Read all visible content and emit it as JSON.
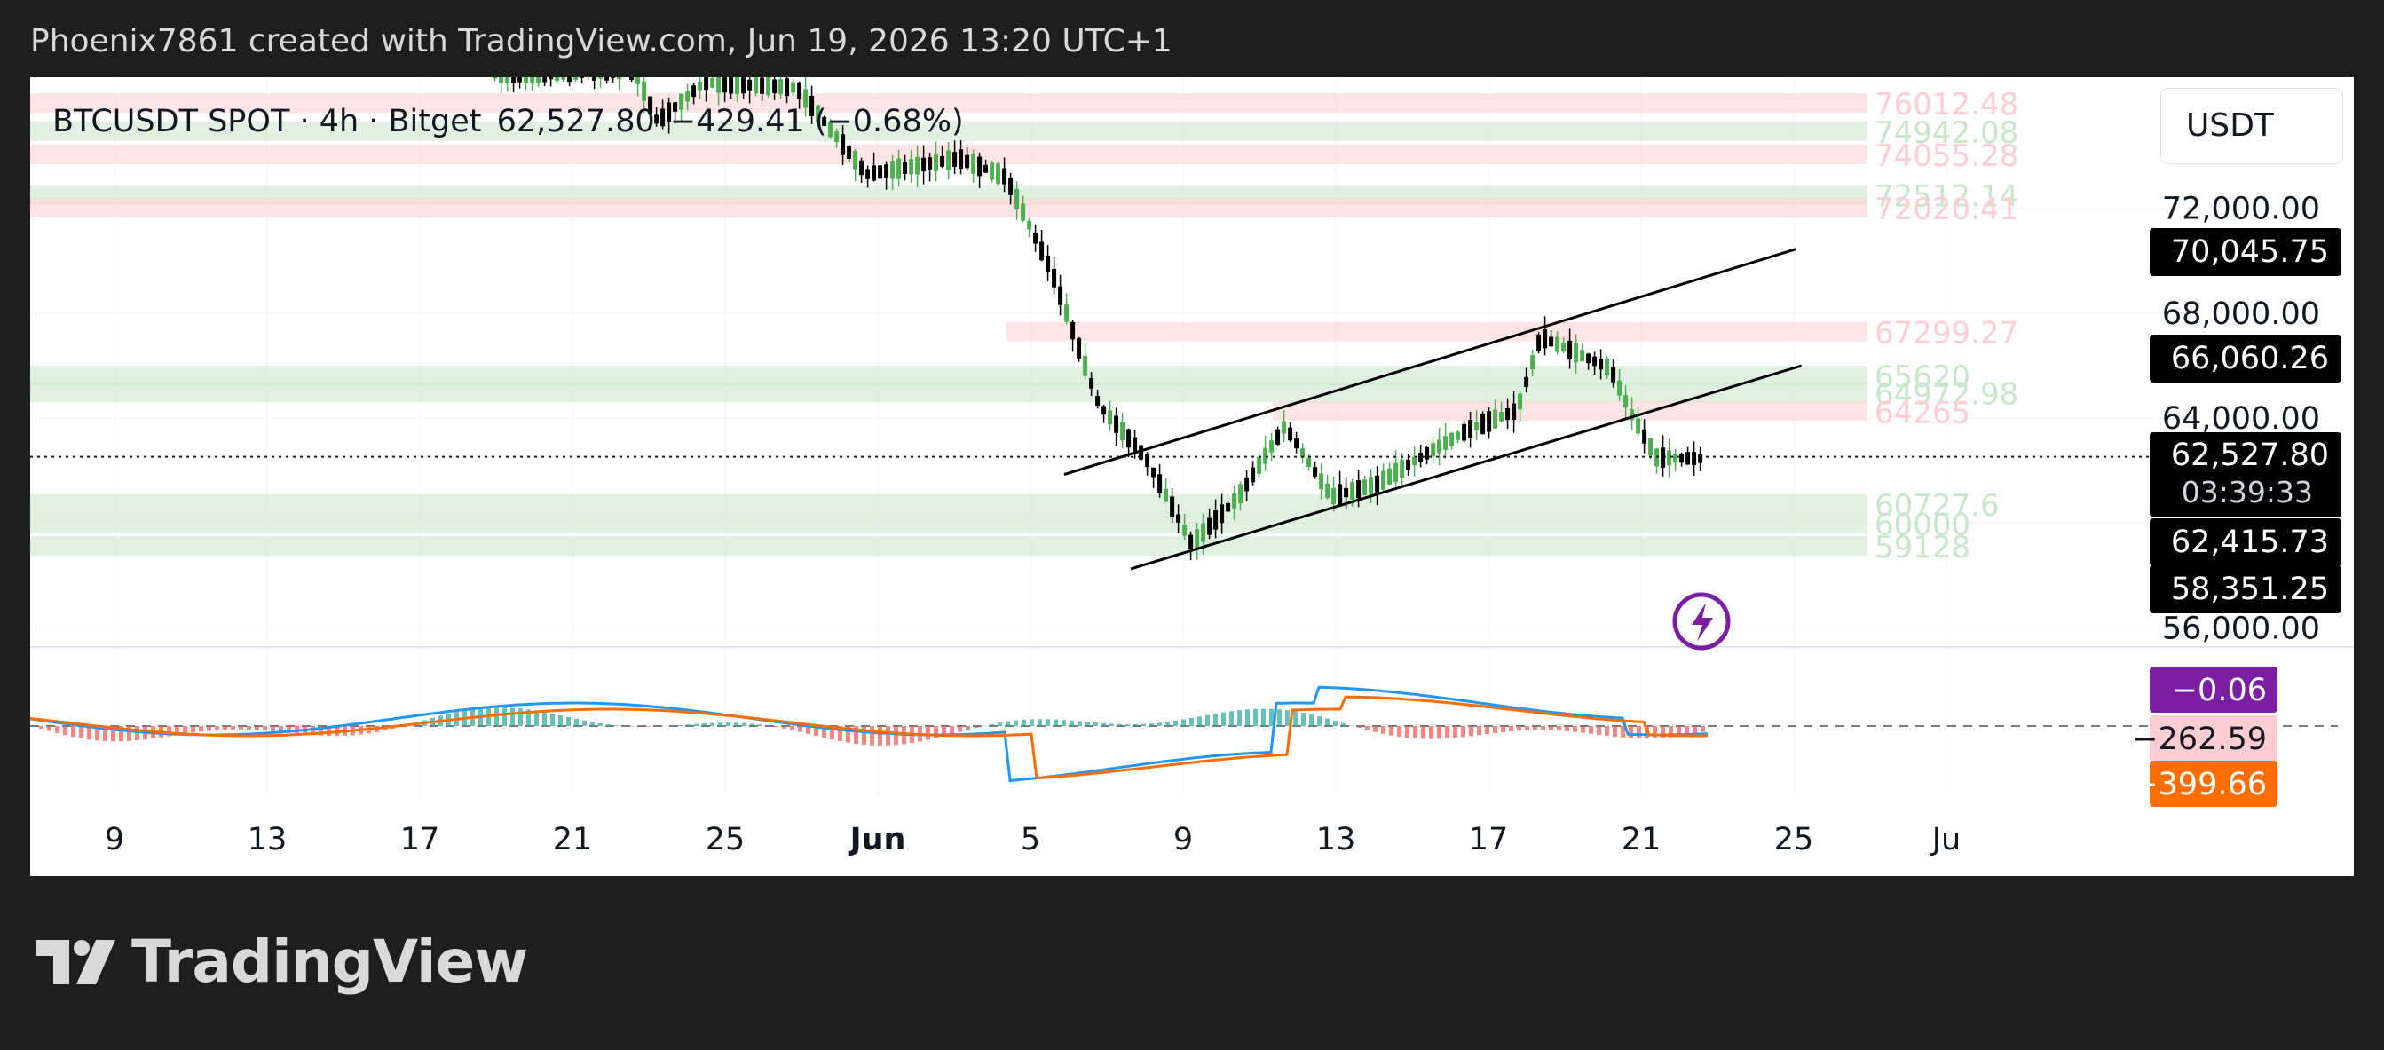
{
  "caption": "Phoenix7861 created with TradingView.com, Jun 19, 2026 13:20 UTC+1",
  "legend": {
    "symbol": "BTCUSDT SPOT · 4h · Bitget",
    "price": "62,527.80",
    "change": "−429.41 (−0.68%)"
  },
  "currency": "USDT",
  "brand": "TradingView",
  "colors": {
    "bull": "#4caf50",
    "bear": "#000000",
    "support_zone": "#c8e6c9",
    "resistance_zone": "#ffcdd2",
    "macd": "#2196f3",
    "signal": "#ff6d00",
    "hist_pos": "#26a69a",
    "hist_neg": "#ef5350",
    "badge_violet": "#7b1fa2"
  },
  "chart_data": {
    "type": "candlestick",
    "title": "BTCUSDT SPOT · 4h · Bitget",
    "timeframe": "4h",
    "x_ticks": [
      "9",
      "13",
      "17",
      "21",
      "25",
      "Jun",
      "5",
      "9",
      "13",
      "17",
      "21",
      "25",
      "Ju"
    ],
    "y_ticks": [
      "72,000.00",
      "68,000.00",
      "64,000.00",
      "56,000.00"
    ],
    "ylim": [
      55000,
      77000
    ],
    "grid": true,
    "last_price": 62527.8,
    "countdown": "03:39:33",
    "price_badges": [
      {
        "text": "70,045.75",
        "value": 70045.75
      },
      {
        "text": "66,060.26",
        "value": 66060.26
      },
      {
        "text": "62,415.73",
        "value": 62415.73
      },
      {
        "text": "58,351.25",
        "value": 58351.25
      }
    ],
    "zones": [
      {
        "label": "76012.48",
        "value": 76012.48,
        "kind": "resistance"
      },
      {
        "label": "74942.08",
        "value": 74942.08,
        "kind": "support"
      },
      {
        "label": "74055.28",
        "value": 74055.28,
        "kind": "resistance"
      },
      {
        "label": "72512.14",
        "value": 72512.14,
        "kind": "support"
      },
      {
        "label": "72020.41",
        "value": 72020.41,
        "kind": "resistance"
      },
      {
        "label": "67299.27",
        "value": 67299.27,
        "kind": "resistance"
      },
      {
        "label": "65620",
        "value": 65620,
        "kind": "support"
      },
      {
        "label": "64972.98",
        "value": 64972.98,
        "kind": "support"
      },
      {
        "label": "64265",
        "value": 64265,
        "kind": "resistance"
      },
      {
        "label": "60727.6",
        "value": 60727.6,
        "kind": "support"
      },
      {
        "label": "60000",
        "value": 60000,
        "kind": "support"
      },
      {
        "label": "59128",
        "value": 59128,
        "kind": "support"
      }
    ],
    "channel": {
      "upper": [
        [
          61850,
          70450
        ]
      ],
      "lower": [
        [
          58250,
          66000
        ]
      ]
    },
    "price_path": [
      {
        "x": 0.2,
        "y": 77100
      },
      {
        "x": 0.26,
        "y": 77300
      },
      {
        "x": 0.27,
        "y": 75300
      },
      {
        "x": 0.29,
        "y": 76800
      },
      {
        "x": 0.33,
        "y": 76600
      },
      {
        "x": 0.36,
        "y": 73300
      },
      {
        "x": 0.4,
        "y": 73900
      },
      {
        "x": 0.42,
        "y": 73200
      },
      {
        "x": 0.44,
        "y": 69500
      },
      {
        "x": 0.46,
        "y": 64500
      },
      {
        "x": 0.48,
        "y": 62500
      },
      {
        "x": 0.5,
        "y": 59200
      },
      {
        "x": 0.52,
        "y": 61000
      },
      {
        "x": 0.54,
        "y": 63700
      },
      {
        "x": 0.56,
        "y": 61000
      },
      {
        "x": 0.58,
        "y": 61500
      },
      {
        "x": 0.6,
        "y": 62600
      },
      {
        "x": 0.62,
        "y": 63600
      },
      {
        "x": 0.64,
        "y": 64300
      },
      {
        "x": 0.65,
        "y": 67100
      },
      {
        "x": 0.68,
        "y": 65900
      },
      {
        "x": 0.69,
        "y": 64000
      },
      {
        "x": 0.7,
        "y": 62500
      },
      {
        "x": 0.72,
        "y": 62450
      }
    ],
    "macd": {
      "labels": [
        {
          "text": "−0.06",
          "bg": "#7b1fa2",
          "fg": "#ffffff"
        },
        {
          "text": "−262.59",
          "bg": "#ffcdd2",
          "fg": "#131722"
        },
        {
          "text": "−399.66",
          "bg": "#ff6d00",
          "fg": "#ffffff"
        }
      ]
    }
  }
}
